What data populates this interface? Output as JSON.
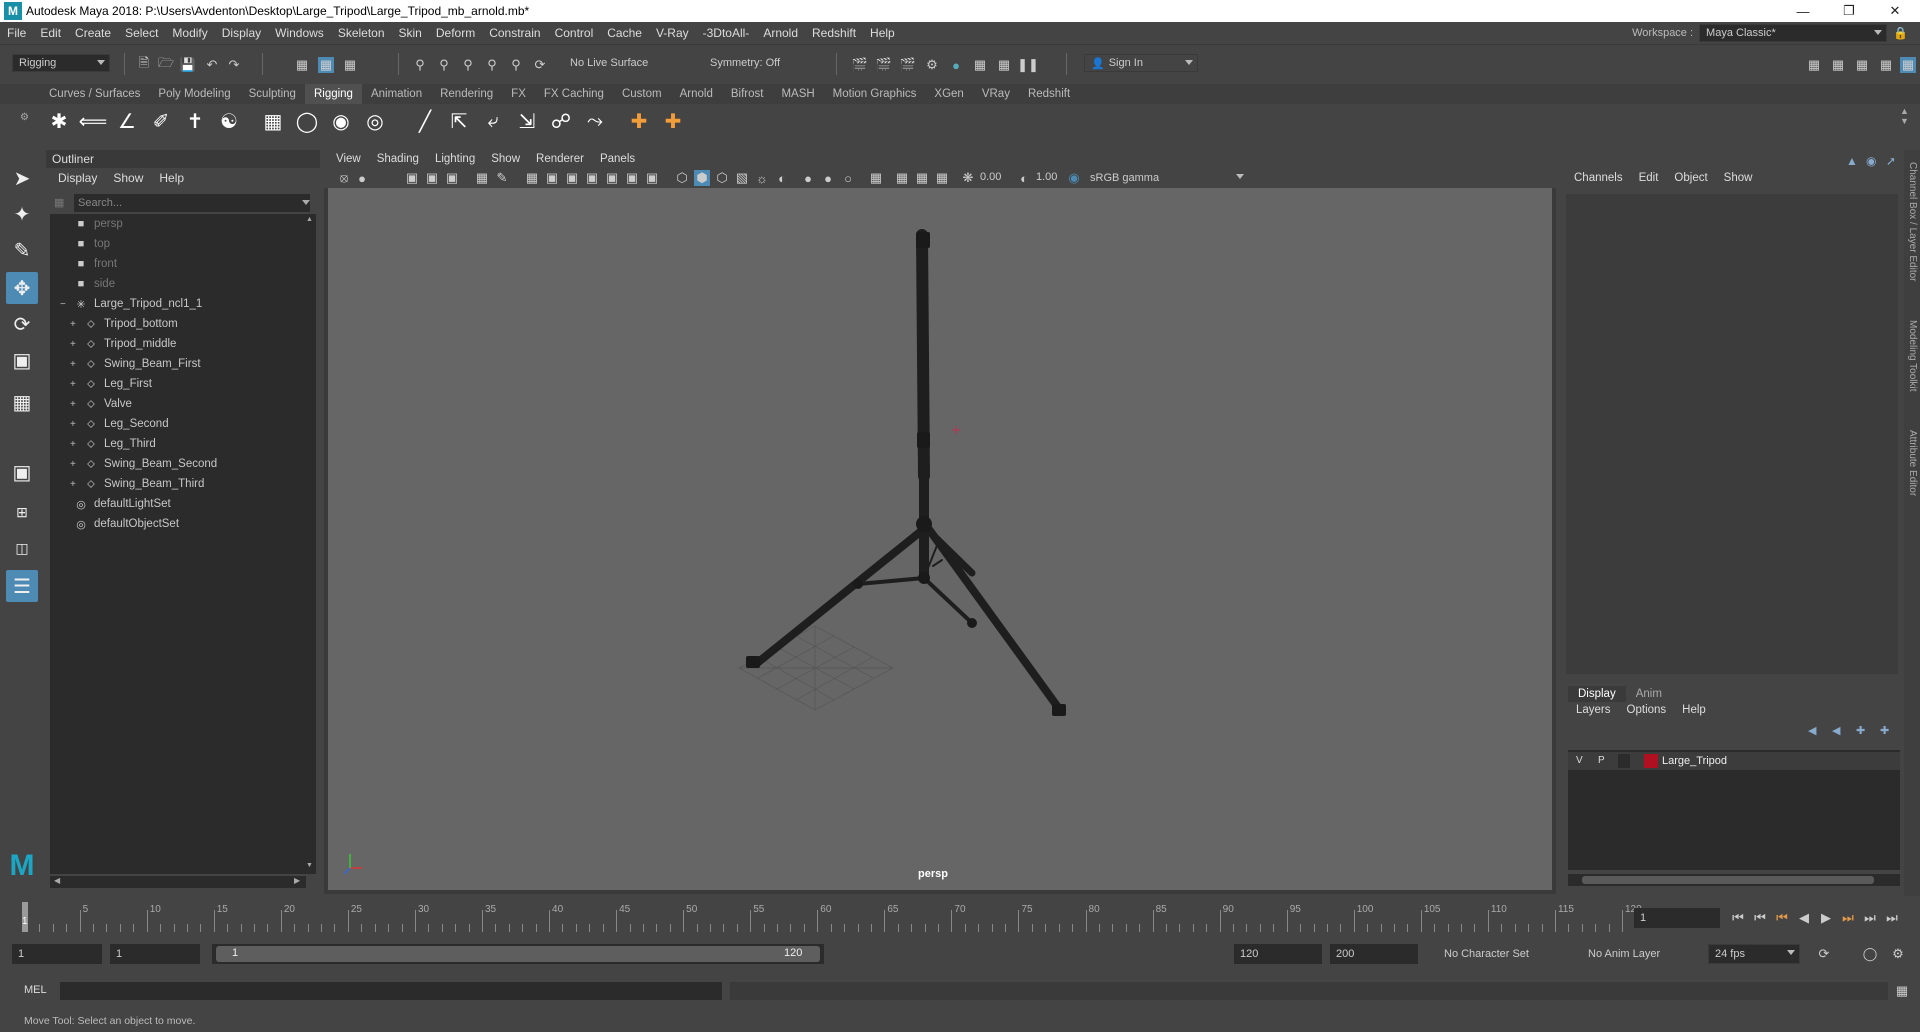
{
  "window": {
    "title": "Autodesk Maya 2018: P:\\Users\\Avdenton\\Desktop\\Large_Tripod\\Large_Tripod_mb_arnold.mb*"
  },
  "menubar": [
    "File",
    "Edit",
    "Create",
    "Select",
    "Modify",
    "Display",
    "Windows",
    "Skeleton",
    "Skin",
    "Deform",
    "Constrain",
    "Control",
    "Cache",
    "V-Ray",
    "-3DtoAll-",
    "Arnold",
    "Redshift",
    "Help"
  ],
  "workspace": {
    "label": "Workspace :",
    "value": "Maya Classic*"
  },
  "statusline": {
    "menuset": "Rigging",
    "live_surface": "No Live Surface",
    "symmetry": "Symmetry: Off",
    "sign_in": "Sign In"
  },
  "shelf_tabs": [
    "Curves / Surfaces",
    "Poly Modeling",
    "Sculpting",
    "Rigging",
    "Animation",
    "Rendering",
    "FX",
    "FX Caching",
    "Custom",
    "Arnold",
    "Bifrost",
    "MASH",
    "Motion Graphics",
    "XGen",
    "VRay",
    "Redshift"
  ],
  "shelf_active_tab": "Rigging",
  "outliner": {
    "title": "Outliner",
    "menus": [
      "Display",
      "Show",
      "Help"
    ],
    "search_placeholder": "Search...",
    "cameras": [
      "persp",
      "top",
      "front",
      "side"
    ],
    "group": "Large_Tripod_ncl1_1",
    "children": [
      "Tripod_bottom",
      "Tripod_middle",
      "Swing_Beam_First",
      "Leg_First",
      "Valve",
      "Leg_Second",
      "Leg_Third",
      "Swing_Beam_Second",
      "Swing_Beam_Third"
    ],
    "sets": [
      "defaultLightSet",
      "defaultObjectSet"
    ]
  },
  "viewport": {
    "menus": [
      "View",
      "Shading",
      "Lighting",
      "Show",
      "Renderer",
      "Panels"
    ],
    "exposure": "0.00",
    "gamma": "1.00",
    "color_space": "sRGB gamma",
    "camera_label": "persp"
  },
  "channel_box": {
    "menus": [
      "Channels",
      "Edit",
      "Object",
      "Show"
    ],
    "side_tabs": [
      "Channel Box / Layer Editor",
      "Modeling Toolkit",
      "Attribute Editor"
    ]
  },
  "layer_editor": {
    "tabs": [
      "Display",
      "Anim"
    ],
    "menus": [
      "Layers",
      "Options",
      "Help"
    ],
    "layer": {
      "v": "V",
      "p": "P",
      "name": "Large_Tripod",
      "color": "#b01020"
    }
  },
  "timeslider": {
    "ticks": [
      "5",
      "10",
      "15",
      "20",
      "25",
      "30",
      "35",
      "40",
      "45",
      "50",
      "55",
      "60",
      "65",
      "70",
      "75",
      "80",
      "85",
      "90",
      "95",
      "100",
      "105",
      "110",
      "115",
      "120"
    ],
    "current_marker": "1",
    "current_frame": "1"
  },
  "range": {
    "start": "1",
    "anim_start": "1",
    "range_start_label": "1",
    "range_end_label": "120",
    "playback_end": "120",
    "anim_end": "200",
    "character_set": "No Character Set",
    "anim_layer": "No Anim Layer",
    "fps": "24 fps"
  },
  "cmdline": {
    "label": "MEL"
  },
  "helpline": "Move Tool: Select an object to move.",
  "colors": {
    "accent": "#4d8bb5",
    "panel": "#444444",
    "viewport_bg": "#666666"
  }
}
